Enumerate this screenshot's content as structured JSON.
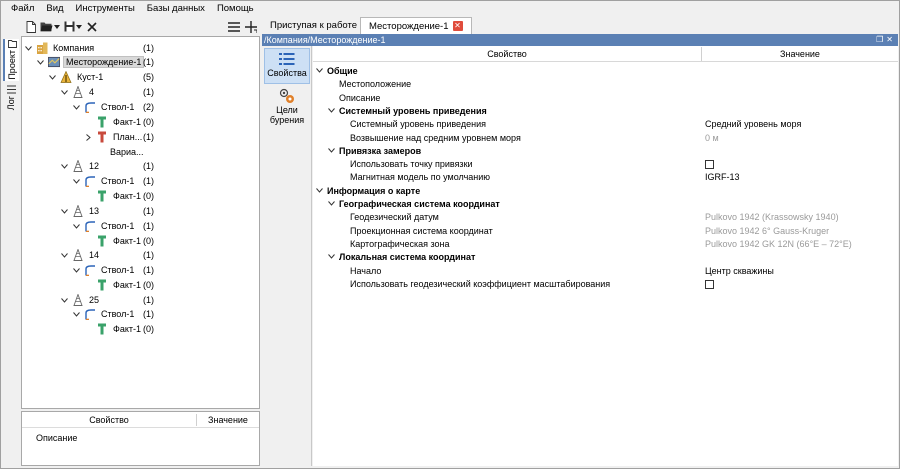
{
  "menu": [
    "Файл",
    "Вид",
    "Инструменты",
    "Базы данных",
    "Помощь"
  ],
  "side_tabs": {
    "project": "Проект",
    "log": "Лог"
  },
  "tree": [
    {
      "label": "Компания",
      "count": "(1)",
      "icon": "company-icon"
    },
    {
      "label": "Месторождение-1",
      "count": "(1)",
      "icon": "field-icon",
      "selected": true
    },
    {
      "label": "Куст-1",
      "count": "(5)",
      "icon": "pad-icon"
    },
    {
      "label": "4",
      "count": "(1)",
      "icon": "well-icon"
    },
    {
      "label": "Ствол-1",
      "count": "(2)",
      "icon": "wellbore-icon"
    },
    {
      "label": "Факт-1",
      "count": "(0)",
      "icon": "fact-icon"
    },
    {
      "label": "План...",
      "count": "(1)",
      "icon": "plan-icon"
    },
    {
      "label": "Вариа...",
      "count": "",
      "icon": ""
    },
    {
      "label": "12",
      "count": "(1)",
      "icon": "well-icon"
    },
    {
      "label": "Ствол-1",
      "count": "(1)",
      "icon": "wellbore-icon"
    },
    {
      "label": "Факт-1",
      "count": "(0)",
      "icon": "fact-icon"
    },
    {
      "label": "13",
      "count": "(1)",
      "icon": "well-icon"
    },
    {
      "label": "Ствол-1",
      "count": "(1)",
      "icon": "wellbore-icon"
    },
    {
      "label": "Факт-1",
      "count": "(0)",
      "icon": "fact-icon"
    },
    {
      "label": "14",
      "count": "(1)",
      "icon": "well-icon"
    },
    {
      "label": "Ствол-1",
      "count": "(1)",
      "icon": "wellbore-icon"
    },
    {
      "label": "Факт-1",
      "count": "(0)",
      "icon": "fact-icon"
    },
    {
      "label": "25",
      "count": "(1)",
      "icon": "well-icon"
    },
    {
      "label": "Ствол-1",
      "count": "(1)",
      "icon": "wellbore-icon"
    },
    {
      "label": "Факт-1",
      "count": "(0)",
      "icon": "fact-icon"
    }
  ],
  "bottom_pane": {
    "col_property": "Свойство",
    "col_value": "Значение",
    "row": "Описание"
  },
  "tabs": [
    {
      "label": "Приступая к работе"
    },
    {
      "label": "Месторождение-1"
    }
  ],
  "path": "/Компания/Месторождение-1",
  "side_buttons": {
    "properties": "Свойства",
    "targets": "Цели бурения"
  },
  "grid": {
    "col_property": "Свойство",
    "col_value": "Значение",
    "rows": [
      {
        "name": "Общие",
        "value": "",
        "type": "cat"
      },
      {
        "name": "Местоположение",
        "value": "",
        "type": "item"
      },
      {
        "name": "Описание",
        "value": "",
        "type": "item"
      },
      {
        "name": "Системный уровень приведения",
        "value": "",
        "type": "subcat"
      },
      {
        "name": "Системный уровень приведения",
        "value": "Средний уровень моря",
        "type": "sub"
      },
      {
        "name": "Возвышение над средним уровнем моря",
        "value": "0 м",
        "type": "sub",
        "gray": true
      },
      {
        "name": "Привязка замеров",
        "value": "",
        "type": "subcat"
      },
      {
        "name": "Использовать точку привязки",
        "value": "",
        "type": "sub",
        "checkbox": true
      },
      {
        "name": "Магнитная модель по умолчанию",
        "value": "IGRF-13",
        "type": "sub"
      },
      {
        "name": "Информация о карте",
        "value": "",
        "type": "cat"
      },
      {
        "name": "Географическая система координат",
        "value": "",
        "type": "subcat"
      },
      {
        "name": "Геодезический датум",
        "value": "Pulkovo 1942 (Krassowsky 1940)",
        "type": "sub",
        "gray": true
      },
      {
        "name": "Проекционная система координат",
        "value": "Pulkovo 1942 6° Gauss-Kruger",
        "type": "sub",
        "gray": true
      },
      {
        "name": "Картографическая зона",
        "value": "Pulkovo 1942 GK 12N (66°E – 72°E)",
        "type": "sub",
        "gray": true
      },
      {
        "name": "Локальная система координат",
        "value": "",
        "type": "subcat"
      },
      {
        "name": "Начало",
        "value": "Центр скважины",
        "type": "sub"
      },
      {
        "name": "Использовать геодезический коэффициент масштабирования",
        "value": "",
        "type": "sub",
        "checkbox": true
      }
    ]
  },
  "colors": {
    "accent": "#5b80b4",
    "selected": "#cde0f5",
    "close": "#e04c3c"
  }
}
